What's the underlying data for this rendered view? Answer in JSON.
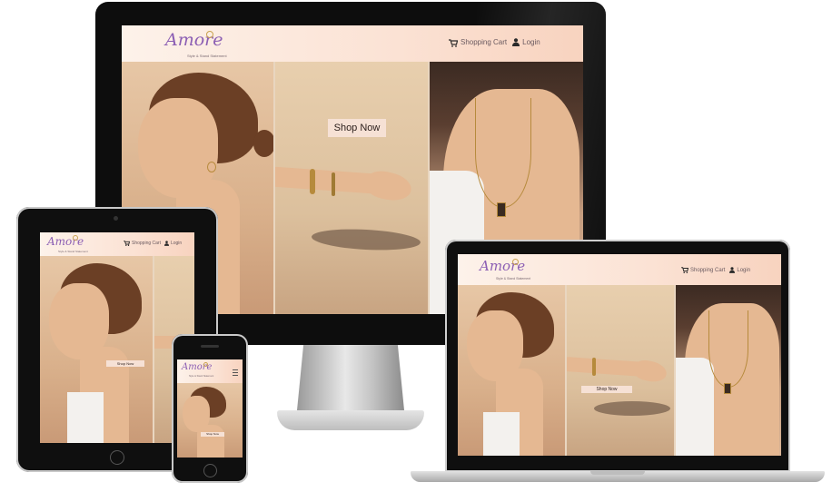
{
  "site": {
    "brand": "Amore",
    "tagline": "Style & Stand Statement",
    "nav": {
      "cart_label": "Shopping Cart",
      "login_label": "Login"
    },
    "hero_button": "Shop Now"
  },
  "colors": {
    "header_gradient_start": "#fdf2ea",
    "header_gradient_end": "#f8d3bf",
    "brand_purple": "#8c5fb4",
    "button_bg": "#f6e1d5",
    "device_frame": "#111111"
  },
  "icons": {
    "cart": "shopping-cart-icon",
    "login": "user-icon",
    "menu": "hamburger-menu-icon"
  }
}
